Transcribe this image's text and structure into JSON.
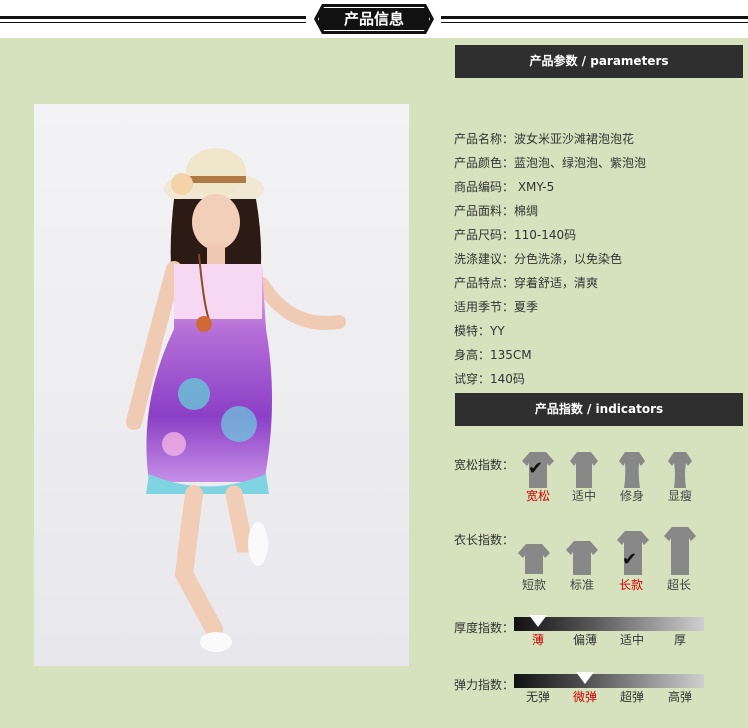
{
  "header": {
    "title": "产品信息"
  },
  "sections": {
    "parameters": "产品参数 / parameters",
    "indicators": "产品指数 / indicators"
  },
  "params": [
    "产品名称：波女米亚沙滩裙泡泡花",
    "产品颜色：蓝泡泡、绿泡泡、紫泡泡",
    "商品编码： XMY-5",
    "产品面料：棉绸",
    "产品尺码：110-140码",
    "洗涤建议：分色洗涤，以免染色",
    "产品特点：穿着舒适，清爽",
    "适用季节：夏季",
    "模特：YY",
    "身高：135CM",
    "试穿：140码"
  ],
  "fit": {
    "label": "宽松指数：",
    "options": [
      "宽松",
      "适中",
      "修身",
      "显瘦"
    ],
    "selected": 0
  },
  "length": {
    "label": "衣长指数：",
    "options": [
      "短款",
      "标准",
      "长款",
      "超长"
    ],
    "selected": 2
  },
  "thickness": {
    "label": "厚度指数：",
    "options": [
      "薄",
      "偏薄",
      "适中",
      "厚"
    ],
    "selected": 0
  },
  "elasticity": {
    "label": "弹力指数：",
    "options": [
      "无弹",
      "微弹",
      "超弹",
      "高弹"
    ],
    "selected": 1
  },
  "colors": {
    "background": "#d5e2bd",
    "header_bar": "#2f2f2f",
    "selected": "#d40000"
  },
  "icons": {
    "fit": "shirt-icon",
    "check": "checkmark-icon"
  }
}
